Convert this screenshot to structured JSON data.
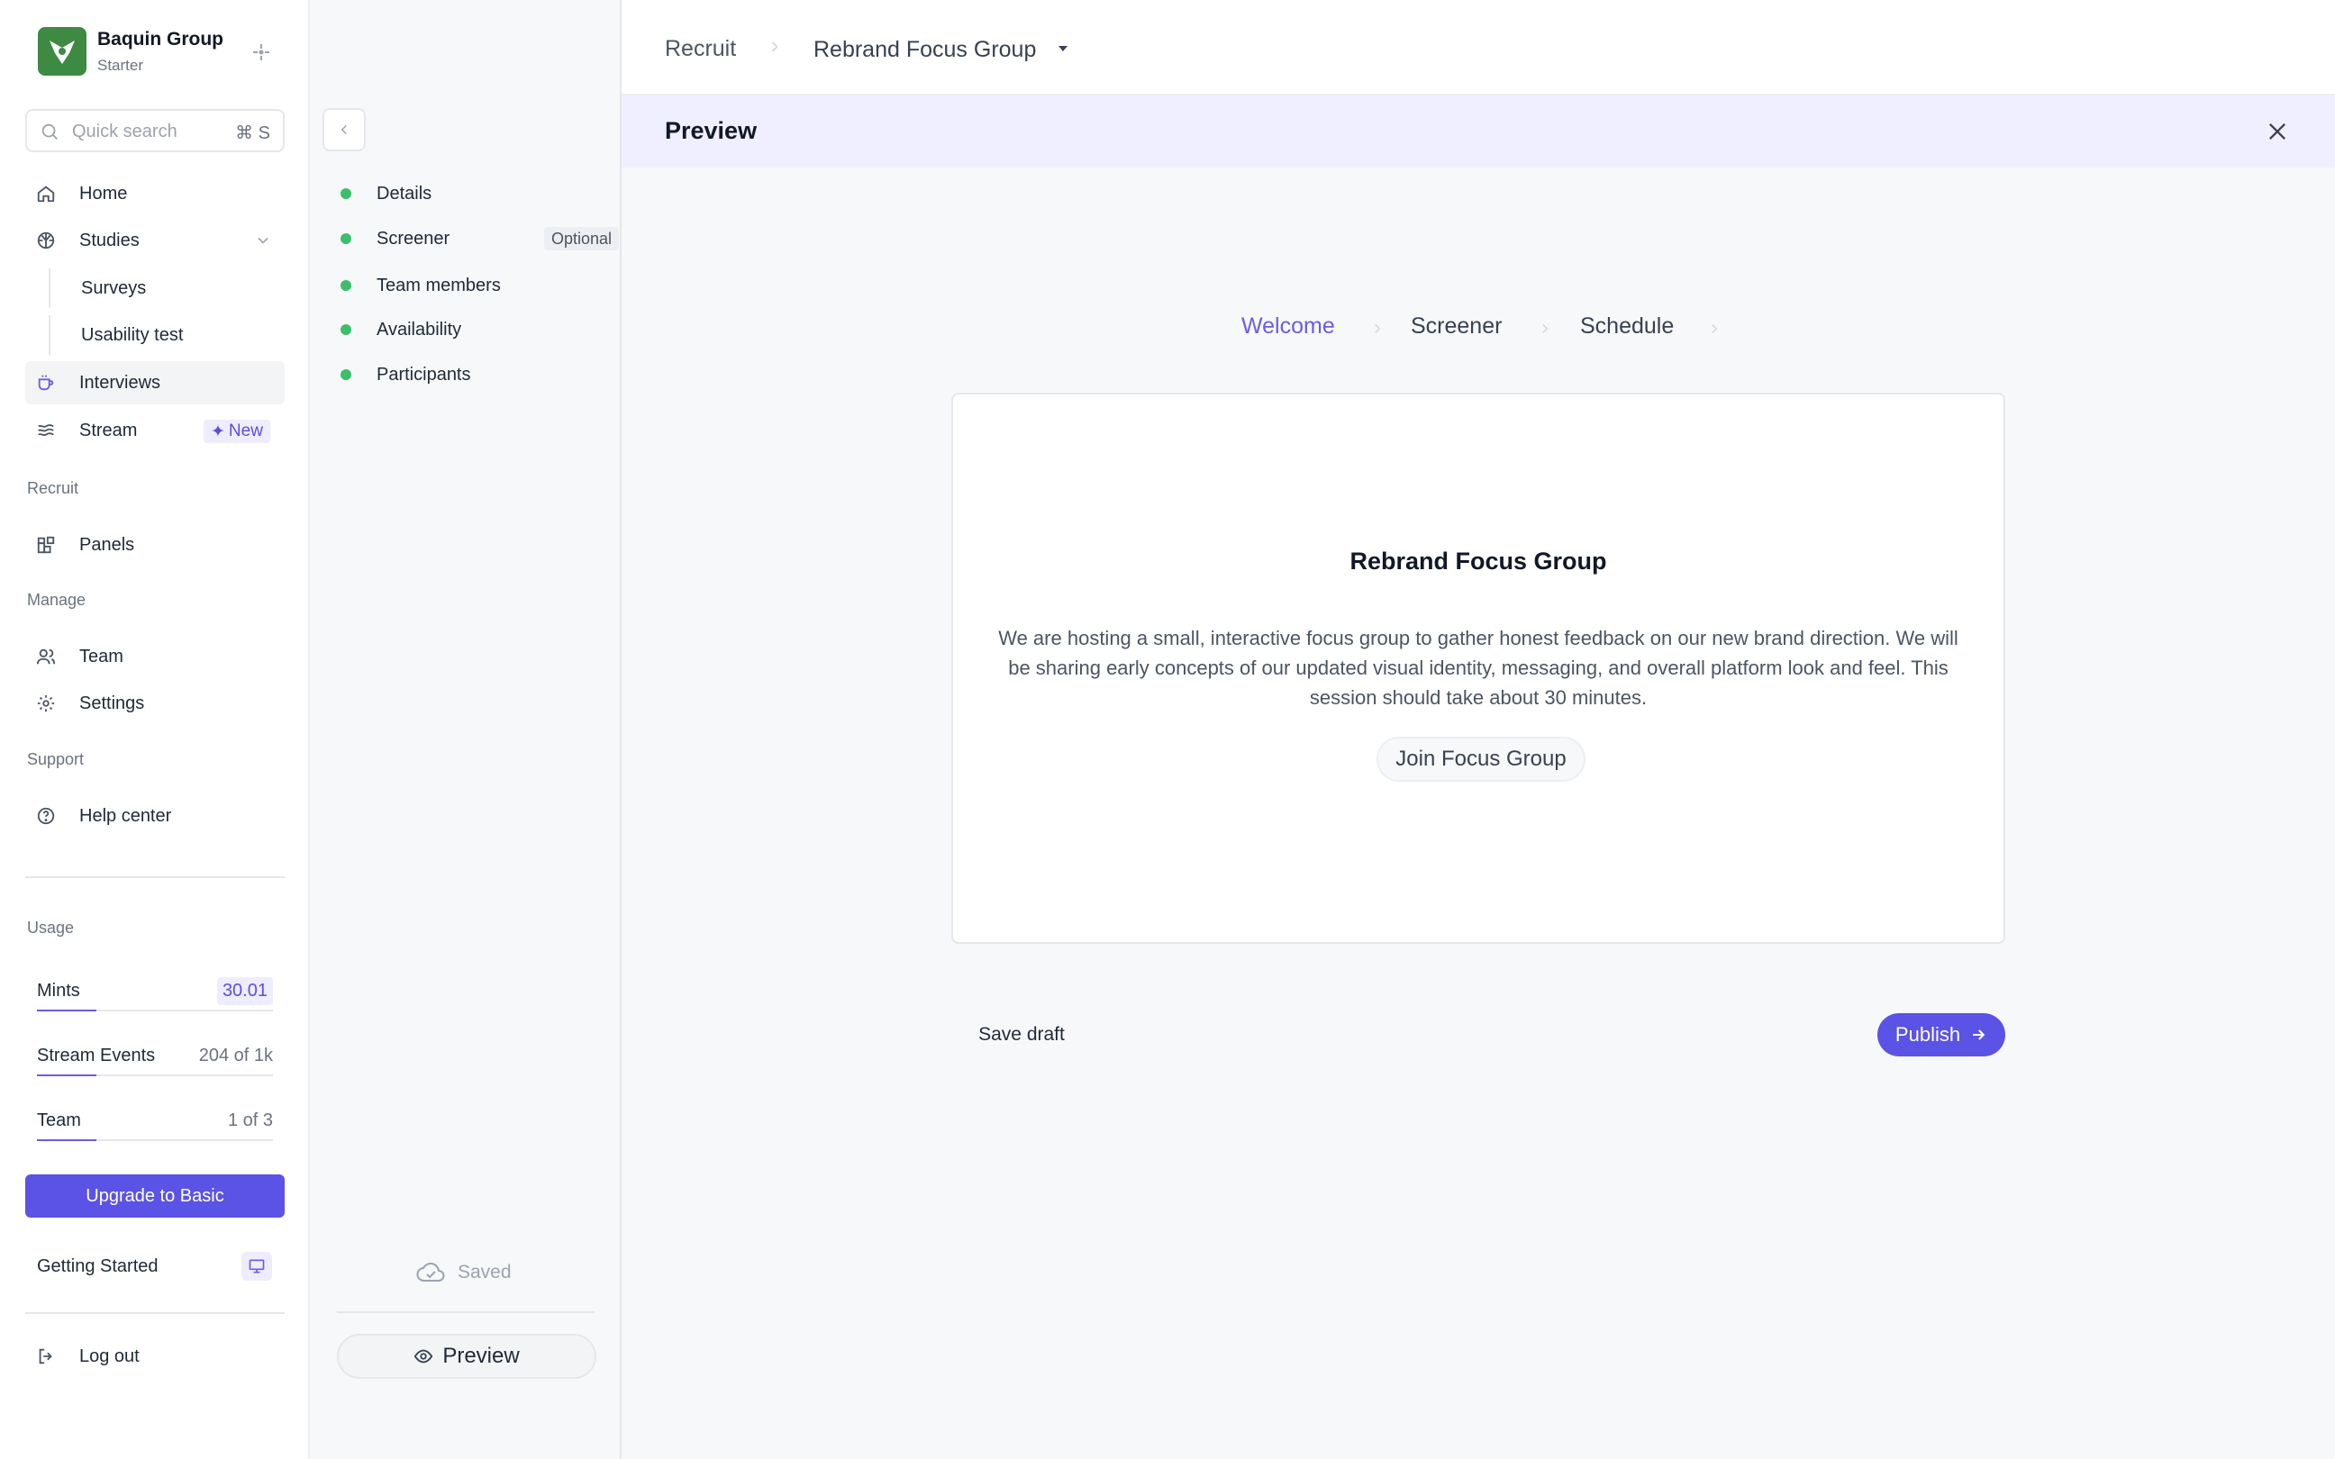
{
  "org": {
    "name": "Baquin Group",
    "plan": "Starter",
    "logo_color": "#3f8a43"
  },
  "search": {
    "placeholder": "Quick search",
    "shortcut": "⌘ S"
  },
  "nav": {
    "home": "Home",
    "studies": "Studies",
    "surveys": "Surveys",
    "usability_test": "Usability test",
    "interviews": "Interviews",
    "stream": "Stream",
    "stream_badge": "New"
  },
  "sections": {
    "recruit": "Recruit",
    "panels": "Panels",
    "manage": "Manage",
    "team": "Team",
    "settings": "Settings",
    "support": "Support",
    "help_center": "Help center"
  },
  "usage": {
    "title": "Usage",
    "rows": [
      {
        "label": "Mints",
        "value": "30.01",
        "progress": 0.25
      },
      {
        "label": "Stream Events",
        "value": "204 of 1k",
        "progress": 0.25
      },
      {
        "label": "Team",
        "value": "1 of 3",
        "progress": 0.25
      }
    ]
  },
  "upgrade_label": "Upgrade to Basic",
  "getting_started": "Getting Started",
  "logout": "Log out",
  "steps": {
    "items": [
      "Details",
      "Screener",
      "Team members",
      "Availability",
      "Participants"
    ],
    "optional_badge": "Optional",
    "status_color": "#3cbf6a",
    "saved": "Saved",
    "preview_button": "Preview"
  },
  "breadcrumb": {
    "parent": "Recruit",
    "current": "Rebrand Focus Group"
  },
  "preview": {
    "title": "Preview",
    "flow": [
      "Welcome",
      "Screener",
      "Schedule"
    ],
    "active_flow": "Welcome",
    "card_title": "Rebrand Focus Group",
    "card_text": "We are hosting a small, interactive focus group to gather honest feedback on our new brand direction. We will be sharing early concepts of our updated visual identity, messaging, and overall platform look and feel. This session should take about 30 minutes.",
    "join_button": "Join Focus Group",
    "save_draft": "Save draft",
    "publish": "Publish"
  },
  "colors": {
    "accent": "#5b52e6",
    "accent_soft": "#eeecff"
  }
}
